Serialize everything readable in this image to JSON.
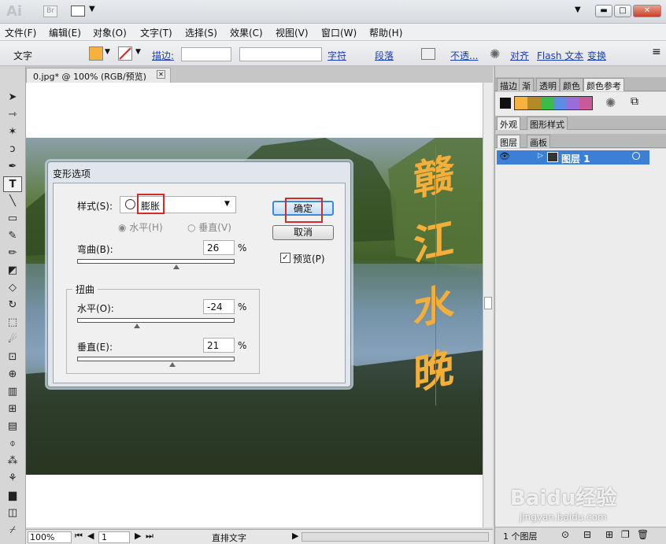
{
  "app": {
    "logo": "Ai",
    "bridge": "Br"
  },
  "menu": [
    "文件(F)",
    "编辑(E)",
    "对象(O)",
    "文字(T)",
    "选择(S)",
    "效果(C)",
    "视图(V)",
    "窗口(W)",
    "帮助(H)"
  ],
  "control": {
    "tool_label": "文字",
    "stroke_label": "描边:",
    "char_link": "字符",
    "para_link": "段落",
    "opacity_link": "不透...",
    "align_link": "对齐",
    "flash_link": "Flash 文本",
    "transform_link": "变换",
    "fill_color": "#f6b23c"
  },
  "document": {
    "tab_title": "0.jpg* @ 100% (RGB/预览)",
    "zoom": "100%",
    "page": "1",
    "status_text": "直排文字"
  },
  "artwork": {
    "text_chars": [
      "赣",
      "江",
      "水",
      "晚"
    ],
    "text_color": "#f4ae3a"
  },
  "panels": {
    "top_tabs": [
      "描边",
      "渐",
      "透明",
      "颜色",
      "颜色参考"
    ],
    "mid_tabs": [
      "外观",
      "图形样式"
    ],
    "layer_tabs": [
      "图层",
      "画板"
    ],
    "layer_name": "图层 1",
    "layer_count": "1 个图层"
  },
  "dialog": {
    "title": "变形选项",
    "style_label": "样式(S):",
    "style_value": "膨胀",
    "horizontal_label": "水平(H)",
    "vertical_label": "垂直(V)",
    "bend_label": "弯曲(B):",
    "bend_value": "26",
    "distort_label": "扭曲",
    "horiz_distort_label": "水平(O):",
    "horiz_distort_value": "-24",
    "vert_distort_label": "垂直(E):",
    "vert_distort_value": "21",
    "percent": "%",
    "ok_label": "确定",
    "cancel_label": "取消",
    "preview_label": "预览(P)",
    "bend_level": 0.26,
    "horiz_level": -0.24,
    "vert_level": 0.21
  },
  "watermark": {
    "text": "Baidu经验",
    "url": "jingyan.baidu.com"
  }
}
